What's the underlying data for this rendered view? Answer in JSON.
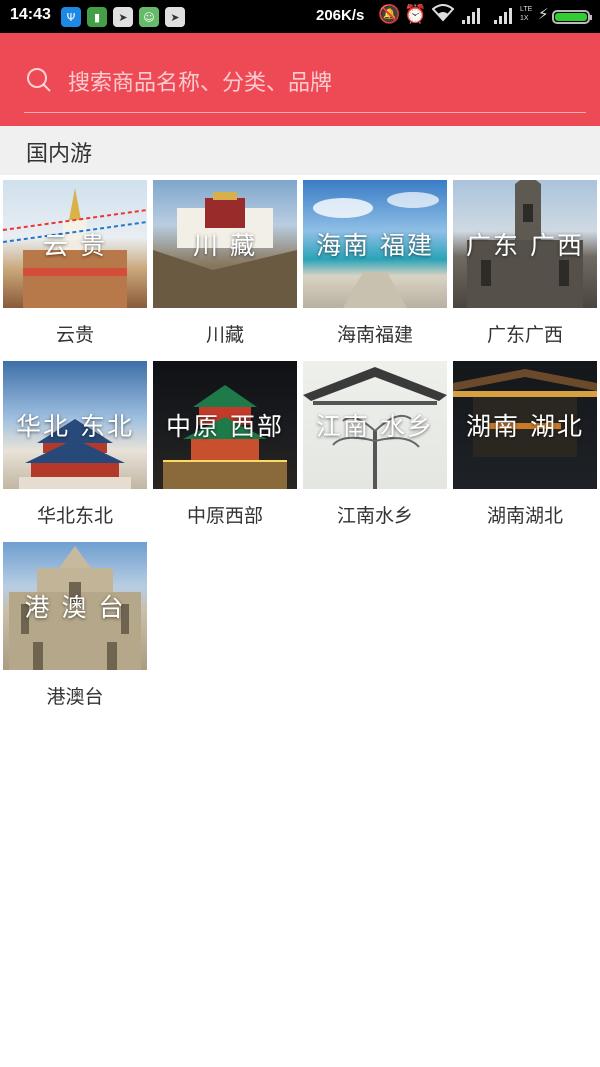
{
  "status_bar": {
    "time": "14:43",
    "speed": "206K/s",
    "network_top": "LTE",
    "network_bottom": "1X"
  },
  "search": {
    "placeholder": "搜索商品名称、分类、品牌"
  },
  "section": {
    "title": "国内游"
  },
  "regions": [
    {
      "overlay": "云  贵",
      "caption": "云贵"
    },
    {
      "overlay": "川  藏",
      "caption": "川藏"
    },
    {
      "overlay": "海南 福建",
      "caption": "海南福建"
    },
    {
      "overlay": "广东 广西",
      "caption": "广东广西"
    },
    {
      "overlay": "华北 东北",
      "caption": "华北东北"
    },
    {
      "overlay": "中原 西部",
      "caption": "中原西部"
    },
    {
      "overlay": "江南 水乡",
      "caption": "江南水乡"
    },
    {
      "overlay": "湖南 湖北",
      "caption": "湖南湖北"
    },
    {
      "overlay": "港 澳 台",
      "caption": "港澳台"
    }
  ],
  "colors": {
    "header": "#ee4a56",
    "section_bg": "#f0f0f0"
  }
}
